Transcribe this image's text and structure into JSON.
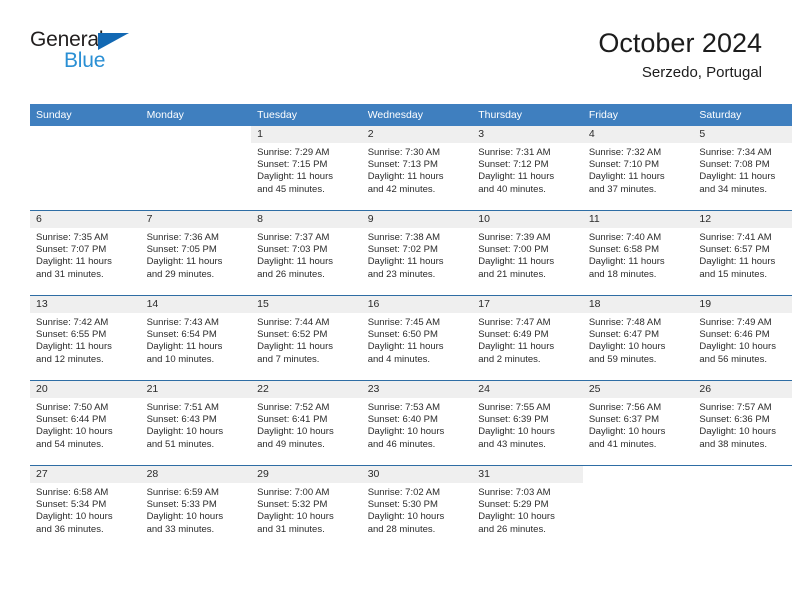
{
  "brand": {
    "name_part1": "General",
    "name_part2": "Blue",
    "triangle_icon": "triangle-icon",
    "accent_dark": "#1268b3",
    "accent_light": "#2a8fd4"
  },
  "header": {
    "title": "October 2024",
    "subtitle": "Serzedo, Portugal"
  },
  "theme": {
    "header_blue": "#3f7fbf",
    "row_divider_blue": "#2e6da4",
    "date_band_gray": "#efefef"
  },
  "calendar": {
    "weekday_headers": [
      "Sunday",
      "Monday",
      "Tuesday",
      "Wednesday",
      "Thursday",
      "Friday",
      "Saturday"
    ],
    "weeks": [
      [
        {
          "date": "",
          "sunrise": "",
          "sunset": "",
          "daylight_line1": "",
          "daylight_line2": ""
        },
        {
          "date": "",
          "sunrise": "",
          "sunset": "",
          "daylight_line1": "",
          "daylight_line2": ""
        },
        {
          "date": "1",
          "sunrise": "Sunrise: 7:29 AM",
          "sunset": "Sunset: 7:15 PM",
          "daylight_line1": "Daylight: 11 hours",
          "daylight_line2": "and 45 minutes."
        },
        {
          "date": "2",
          "sunrise": "Sunrise: 7:30 AM",
          "sunset": "Sunset: 7:13 PM",
          "daylight_line1": "Daylight: 11 hours",
          "daylight_line2": "and 42 minutes."
        },
        {
          "date": "3",
          "sunrise": "Sunrise: 7:31 AM",
          "sunset": "Sunset: 7:12 PM",
          "daylight_line1": "Daylight: 11 hours",
          "daylight_line2": "and 40 minutes."
        },
        {
          "date": "4",
          "sunrise": "Sunrise: 7:32 AM",
          "sunset": "Sunset: 7:10 PM",
          "daylight_line1": "Daylight: 11 hours",
          "daylight_line2": "and 37 minutes."
        },
        {
          "date": "5",
          "sunrise": "Sunrise: 7:34 AM",
          "sunset": "Sunset: 7:08 PM",
          "daylight_line1": "Daylight: 11 hours",
          "daylight_line2": "and 34 minutes."
        }
      ],
      [
        {
          "date": "6",
          "sunrise": "Sunrise: 7:35 AM",
          "sunset": "Sunset: 7:07 PM",
          "daylight_line1": "Daylight: 11 hours",
          "daylight_line2": "and 31 minutes."
        },
        {
          "date": "7",
          "sunrise": "Sunrise: 7:36 AM",
          "sunset": "Sunset: 7:05 PM",
          "daylight_line1": "Daylight: 11 hours",
          "daylight_line2": "and 29 minutes."
        },
        {
          "date": "8",
          "sunrise": "Sunrise: 7:37 AM",
          "sunset": "Sunset: 7:03 PM",
          "daylight_line1": "Daylight: 11 hours",
          "daylight_line2": "and 26 minutes."
        },
        {
          "date": "9",
          "sunrise": "Sunrise: 7:38 AM",
          "sunset": "Sunset: 7:02 PM",
          "daylight_line1": "Daylight: 11 hours",
          "daylight_line2": "and 23 minutes."
        },
        {
          "date": "10",
          "sunrise": "Sunrise: 7:39 AM",
          "sunset": "Sunset: 7:00 PM",
          "daylight_line1": "Daylight: 11 hours",
          "daylight_line2": "and 21 minutes."
        },
        {
          "date": "11",
          "sunrise": "Sunrise: 7:40 AM",
          "sunset": "Sunset: 6:58 PM",
          "daylight_line1": "Daylight: 11 hours",
          "daylight_line2": "and 18 minutes."
        },
        {
          "date": "12",
          "sunrise": "Sunrise: 7:41 AM",
          "sunset": "Sunset: 6:57 PM",
          "daylight_line1": "Daylight: 11 hours",
          "daylight_line2": "and 15 minutes."
        }
      ],
      [
        {
          "date": "13",
          "sunrise": "Sunrise: 7:42 AM",
          "sunset": "Sunset: 6:55 PM",
          "daylight_line1": "Daylight: 11 hours",
          "daylight_line2": "and 12 minutes."
        },
        {
          "date": "14",
          "sunrise": "Sunrise: 7:43 AM",
          "sunset": "Sunset: 6:54 PM",
          "daylight_line1": "Daylight: 11 hours",
          "daylight_line2": "and 10 minutes."
        },
        {
          "date": "15",
          "sunrise": "Sunrise: 7:44 AM",
          "sunset": "Sunset: 6:52 PM",
          "daylight_line1": "Daylight: 11 hours",
          "daylight_line2": "and 7 minutes."
        },
        {
          "date": "16",
          "sunrise": "Sunrise: 7:45 AM",
          "sunset": "Sunset: 6:50 PM",
          "daylight_line1": "Daylight: 11 hours",
          "daylight_line2": "and 4 minutes."
        },
        {
          "date": "17",
          "sunrise": "Sunrise: 7:47 AM",
          "sunset": "Sunset: 6:49 PM",
          "daylight_line1": "Daylight: 11 hours",
          "daylight_line2": "and 2 minutes."
        },
        {
          "date": "18",
          "sunrise": "Sunrise: 7:48 AM",
          "sunset": "Sunset: 6:47 PM",
          "daylight_line1": "Daylight: 10 hours",
          "daylight_line2": "and 59 minutes."
        },
        {
          "date": "19",
          "sunrise": "Sunrise: 7:49 AM",
          "sunset": "Sunset: 6:46 PM",
          "daylight_line1": "Daylight: 10 hours",
          "daylight_line2": "and 56 minutes."
        }
      ],
      [
        {
          "date": "20",
          "sunrise": "Sunrise: 7:50 AM",
          "sunset": "Sunset: 6:44 PM",
          "daylight_line1": "Daylight: 10 hours",
          "daylight_line2": "and 54 minutes."
        },
        {
          "date": "21",
          "sunrise": "Sunrise: 7:51 AM",
          "sunset": "Sunset: 6:43 PM",
          "daylight_line1": "Daylight: 10 hours",
          "daylight_line2": "and 51 minutes."
        },
        {
          "date": "22",
          "sunrise": "Sunrise: 7:52 AM",
          "sunset": "Sunset: 6:41 PM",
          "daylight_line1": "Daylight: 10 hours",
          "daylight_line2": "and 49 minutes."
        },
        {
          "date": "23",
          "sunrise": "Sunrise: 7:53 AM",
          "sunset": "Sunset: 6:40 PM",
          "daylight_line1": "Daylight: 10 hours",
          "daylight_line2": "and 46 minutes."
        },
        {
          "date": "24",
          "sunrise": "Sunrise: 7:55 AM",
          "sunset": "Sunset: 6:39 PM",
          "daylight_line1": "Daylight: 10 hours",
          "daylight_line2": "and 43 minutes."
        },
        {
          "date": "25",
          "sunrise": "Sunrise: 7:56 AM",
          "sunset": "Sunset: 6:37 PM",
          "daylight_line1": "Daylight: 10 hours",
          "daylight_line2": "and 41 minutes."
        },
        {
          "date": "26",
          "sunrise": "Sunrise: 7:57 AM",
          "sunset": "Sunset: 6:36 PM",
          "daylight_line1": "Daylight: 10 hours",
          "daylight_line2": "and 38 minutes."
        }
      ],
      [
        {
          "date": "27",
          "sunrise": "Sunrise: 6:58 AM",
          "sunset": "Sunset: 5:34 PM",
          "daylight_line1": "Daylight: 10 hours",
          "daylight_line2": "and 36 minutes."
        },
        {
          "date": "28",
          "sunrise": "Sunrise: 6:59 AM",
          "sunset": "Sunset: 5:33 PM",
          "daylight_line1": "Daylight: 10 hours",
          "daylight_line2": "and 33 minutes."
        },
        {
          "date": "29",
          "sunrise": "Sunrise: 7:00 AM",
          "sunset": "Sunset: 5:32 PM",
          "daylight_line1": "Daylight: 10 hours",
          "daylight_line2": "and 31 minutes."
        },
        {
          "date": "30",
          "sunrise": "Sunrise: 7:02 AM",
          "sunset": "Sunset: 5:30 PM",
          "daylight_line1": "Daylight: 10 hours",
          "daylight_line2": "and 28 minutes."
        },
        {
          "date": "31",
          "sunrise": "Sunrise: 7:03 AM",
          "sunset": "Sunset: 5:29 PM",
          "daylight_line1": "Daylight: 10 hours",
          "daylight_line2": "and 26 minutes."
        },
        {
          "date": "",
          "sunrise": "",
          "sunset": "",
          "daylight_line1": "",
          "daylight_line2": ""
        },
        {
          "date": "",
          "sunrise": "",
          "sunset": "",
          "daylight_line1": "",
          "daylight_line2": ""
        }
      ]
    ]
  }
}
